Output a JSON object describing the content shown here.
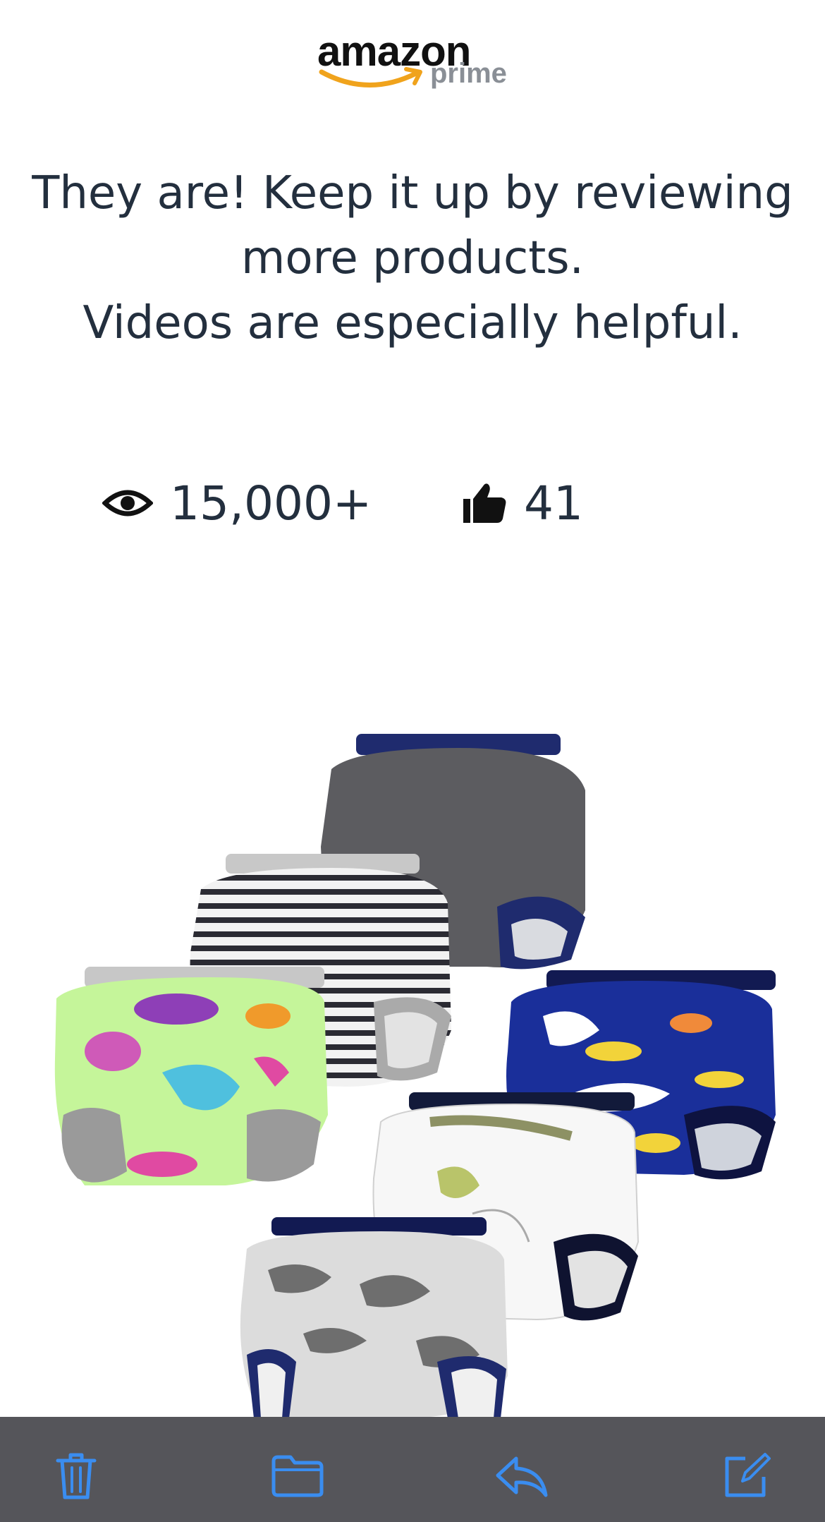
{
  "logo": {
    "word": "amazon",
    "sub": "prime"
  },
  "message": {
    "line1": "They are! Keep it up by reviewing",
    "line2": "more products.",
    "line3": "Videos are especially helpful."
  },
  "stats": {
    "views": {
      "icon": "eye-icon",
      "value": "15,000+"
    },
    "likes": {
      "icon": "thumbs-up-icon",
      "value": "41"
    }
  },
  "product_image": {
    "description": "Six toddler training underpants"
  },
  "toolbar": {
    "items": [
      {
        "icon": "trash-icon"
      },
      {
        "icon": "folder-icon"
      },
      {
        "icon": "reply-icon"
      },
      {
        "icon": "compose-icon"
      }
    ]
  },
  "colors": {
    "text": "#232f3e",
    "toolbar": "#55555a",
    "toolbar_icon": "#3a8df0",
    "logo_smile": "#f0a31c"
  }
}
